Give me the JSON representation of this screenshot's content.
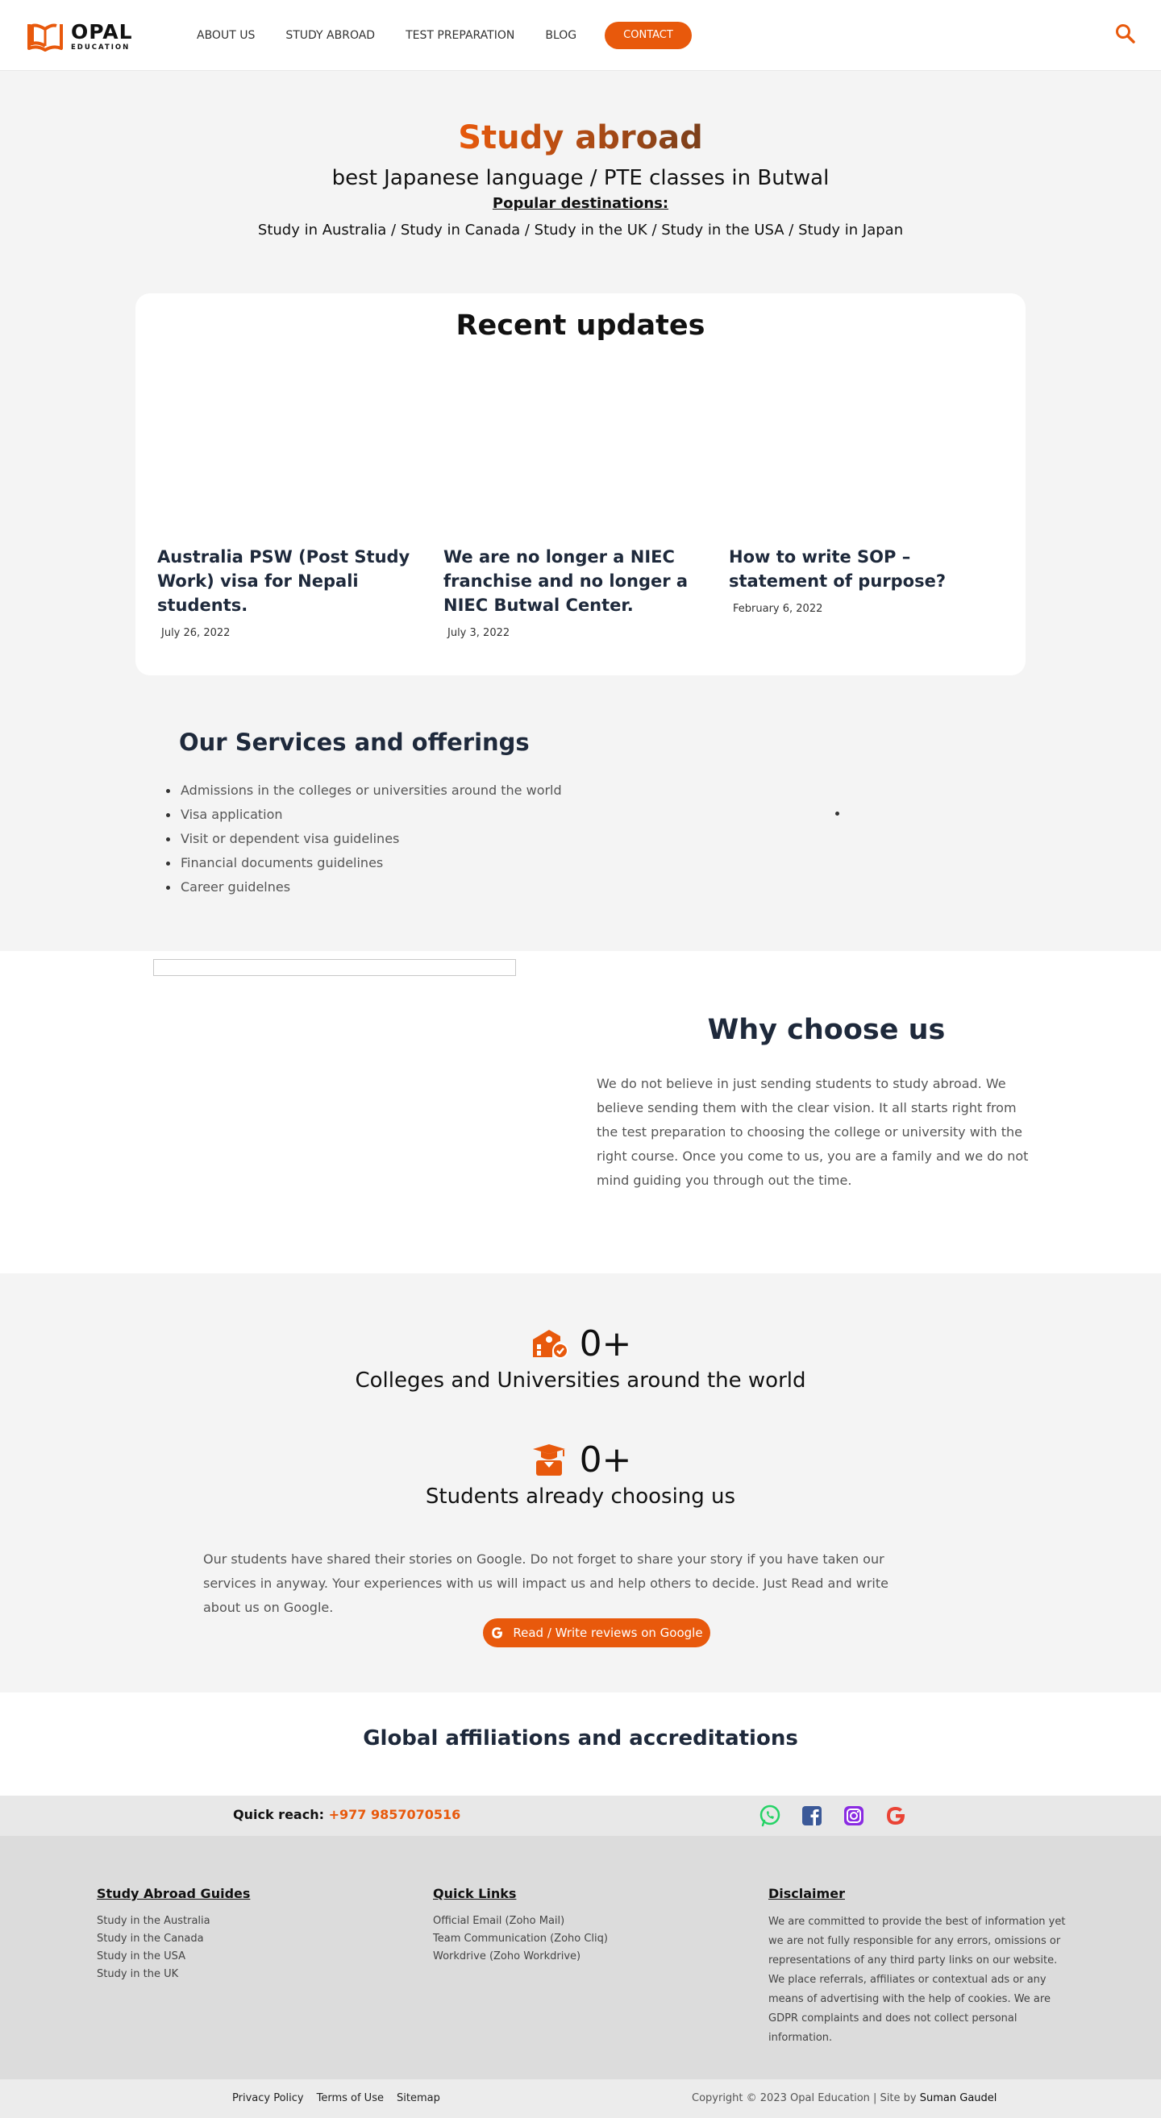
{
  "brand": {
    "name": "OPAL",
    "sub": "EDUCATION",
    "accent": "#e8590c"
  },
  "nav": {
    "items": [
      {
        "label": "ABOUT US"
      },
      {
        "label": "STUDY ABROAD"
      },
      {
        "label": "TEST PREPARATION"
      },
      {
        "label": "BLOG"
      }
    ],
    "contact_label": "CONTACT"
  },
  "hero": {
    "title": "Study abroad",
    "subtitle": "best Japanese language / PTE classes in Butwal",
    "popular_label": "Popular destinations:",
    "destinations": "Study in Australia / Study in Canada / Study in the UK / Study in the USA / Study in Japan"
  },
  "updates": {
    "title": "Recent updates",
    "posts": [
      {
        "title": "Australia PSW (Post Study Work) visa for Nepali students.",
        "date": "July 26, 2022"
      },
      {
        "title": "We are no longer a NIEC franchise and no longer a NIEC Butwal Center.",
        "date": "July 3, 2022"
      },
      {
        "title": "How to write SOP – statement of purpose?",
        "date": "February 6, 2022"
      }
    ]
  },
  "services": {
    "title": "Our Services and offerings",
    "items": [
      "Admissions in the colleges or universities around the world",
      "Visa application",
      "Visit or dependent visa guidelines",
      "Financial documents guidelines",
      "Career guidelnes"
    ]
  },
  "why": {
    "title": "Why choose us",
    "text": "We do not believe in just sending students to study abroad. We believe sending them with the clear vision. It all starts right from the test preparation to choosing the college or university with the right course. Once you come to us, you are a family and we do not mind guiding you through out the time."
  },
  "stats": {
    "items": [
      {
        "icon": "school-icon",
        "value": "0+",
        "label": "Colleges and Universities around the world"
      },
      {
        "icon": "graduate-icon",
        "value": "0+",
        "label": "Students already choosing us"
      }
    ],
    "text": "Our students have shared their stories on Google. Do not forget to share your story if you have taken our services in anyway. Your experiences with us will impact us and help others to decide. Just Read and write about us on Google.",
    "review_button": "Read / Write reviews on Google"
  },
  "affiliations": {
    "title": "Global affiliations and accreditations"
  },
  "quick_reach": {
    "label": "Quick reach:",
    "phone": "+977 9857070516"
  },
  "footer": {
    "guides": {
      "title": "Study Abroad Guides",
      "links": [
        "Study in the Australia",
        "Study in the Canada",
        "Study in the USA",
        "Study in the UK"
      ]
    },
    "quick_links": {
      "title": "Quick Links",
      "links": [
        "Official Email (Zoho Mail)",
        "Team Communication (Zoho Cliq)",
        "Workdrive (Zoho Workdrive)"
      ]
    },
    "disclaimer": {
      "title": "Disclaimer",
      "text": "We are committed to provide the best of information yet we are not fully responsible for any errors, omissions or representations of any third party links on our website.  We place referrals, affiliates or contextual ads or any means of advertising with the help of cookies. We are GDPR complaints and does not collect personal information."
    },
    "bottom_links": [
      "Privacy Policy",
      "Terms of Use",
      "Sitemap"
    ],
    "copyright": "Copyright © 2023 Opal Education | Site by",
    "credit": "Suman Gaudel"
  }
}
